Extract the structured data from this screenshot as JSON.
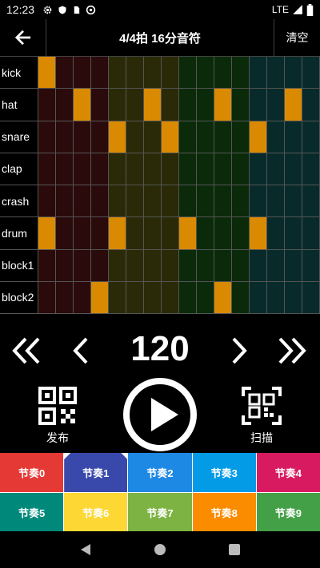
{
  "status": {
    "time": "12:23",
    "network": "LTE",
    "left_icons": [
      "gear-icon",
      "shield-icon",
      "sim-icon",
      "at-icon"
    ],
    "right_icons": [
      "signal-icon",
      "battery-icon"
    ]
  },
  "header": {
    "title": "4/4拍 16分音符",
    "clear_label": "清空"
  },
  "sequencer": {
    "colors": {
      "active": "#d98a00",
      "group1": "#2a0a0a",
      "group2": "#2a2a08",
      "group3": "#0a2a0a",
      "group4": "#082a2a"
    },
    "tracks": [
      {
        "label": "kick",
        "steps": [
          1,
          0,
          0,
          0,
          0,
          0,
          0,
          0,
          0,
          0,
          0,
          0,
          0,
          0,
          0,
          0
        ]
      },
      {
        "label": "hat",
        "steps": [
          0,
          0,
          1,
          0,
          0,
          0,
          1,
          0,
          0,
          0,
          1,
          0,
          0,
          0,
          1,
          0
        ]
      },
      {
        "label": "snare",
        "steps": [
          0,
          0,
          0,
          0,
          1,
          0,
          0,
          1,
          0,
          0,
          0,
          0,
          1,
          0,
          0,
          0
        ]
      },
      {
        "label": "clap",
        "steps": [
          0,
          0,
          0,
          0,
          0,
          0,
          0,
          0,
          0,
          0,
          0,
          0,
          0,
          0,
          0,
          0
        ]
      },
      {
        "label": "crash",
        "steps": [
          0,
          0,
          0,
          0,
          0,
          0,
          0,
          0,
          0,
          0,
          0,
          0,
          0,
          0,
          0,
          0
        ]
      },
      {
        "label": "drum",
        "steps": [
          1,
          0,
          0,
          0,
          1,
          0,
          0,
          0,
          1,
          0,
          0,
          0,
          1,
          0,
          0,
          0
        ]
      },
      {
        "label": "block1",
        "steps": [
          0,
          0,
          0,
          0,
          0,
          0,
          0,
          0,
          0,
          0,
          0,
          0,
          0,
          0,
          0,
          0
        ]
      },
      {
        "label": "block2",
        "steps": [
          0,
          0,
          0,
          1,
          0,
          0,
          0,
          0,
          0,
          0,
          1,
          0,
          0,
          0,
          0,
          0
        ]
      }
    ]
  },
  "transport": {
    "tempo": "120"
  },
  "actions": {
    "publish_label": "发布",
    "scan_label": "扫描"
  },
  "presets": [
    {
      "label": "节奏0",
      "color": "#e53935"
    },
    {
      "label": "节奏1",
      "color": "#3949ab",
      "selected": true
    },
    {
      "label": "节奏2",
      "color": "#1e88e5"
    },
    {
      "label": "节奏3",
      "color": "#039be5"
    },
    {
      "label": "节奏4",
      "color": "#d81b60"
    },
    {
      "label": "节奏5",
      "color": "#00897b"
    },
    {
      "label": "节奏6",
      "color": "#fdd835"
    },
    {
      "label": "节奏7",
      "color": "#7cb342"
    },
    {
      "label": "节奏8",
      "color": "#fb8c00"
    },
    {
      "label": "节奏9",
      "color": "#43a047"
    }
  ]
}
